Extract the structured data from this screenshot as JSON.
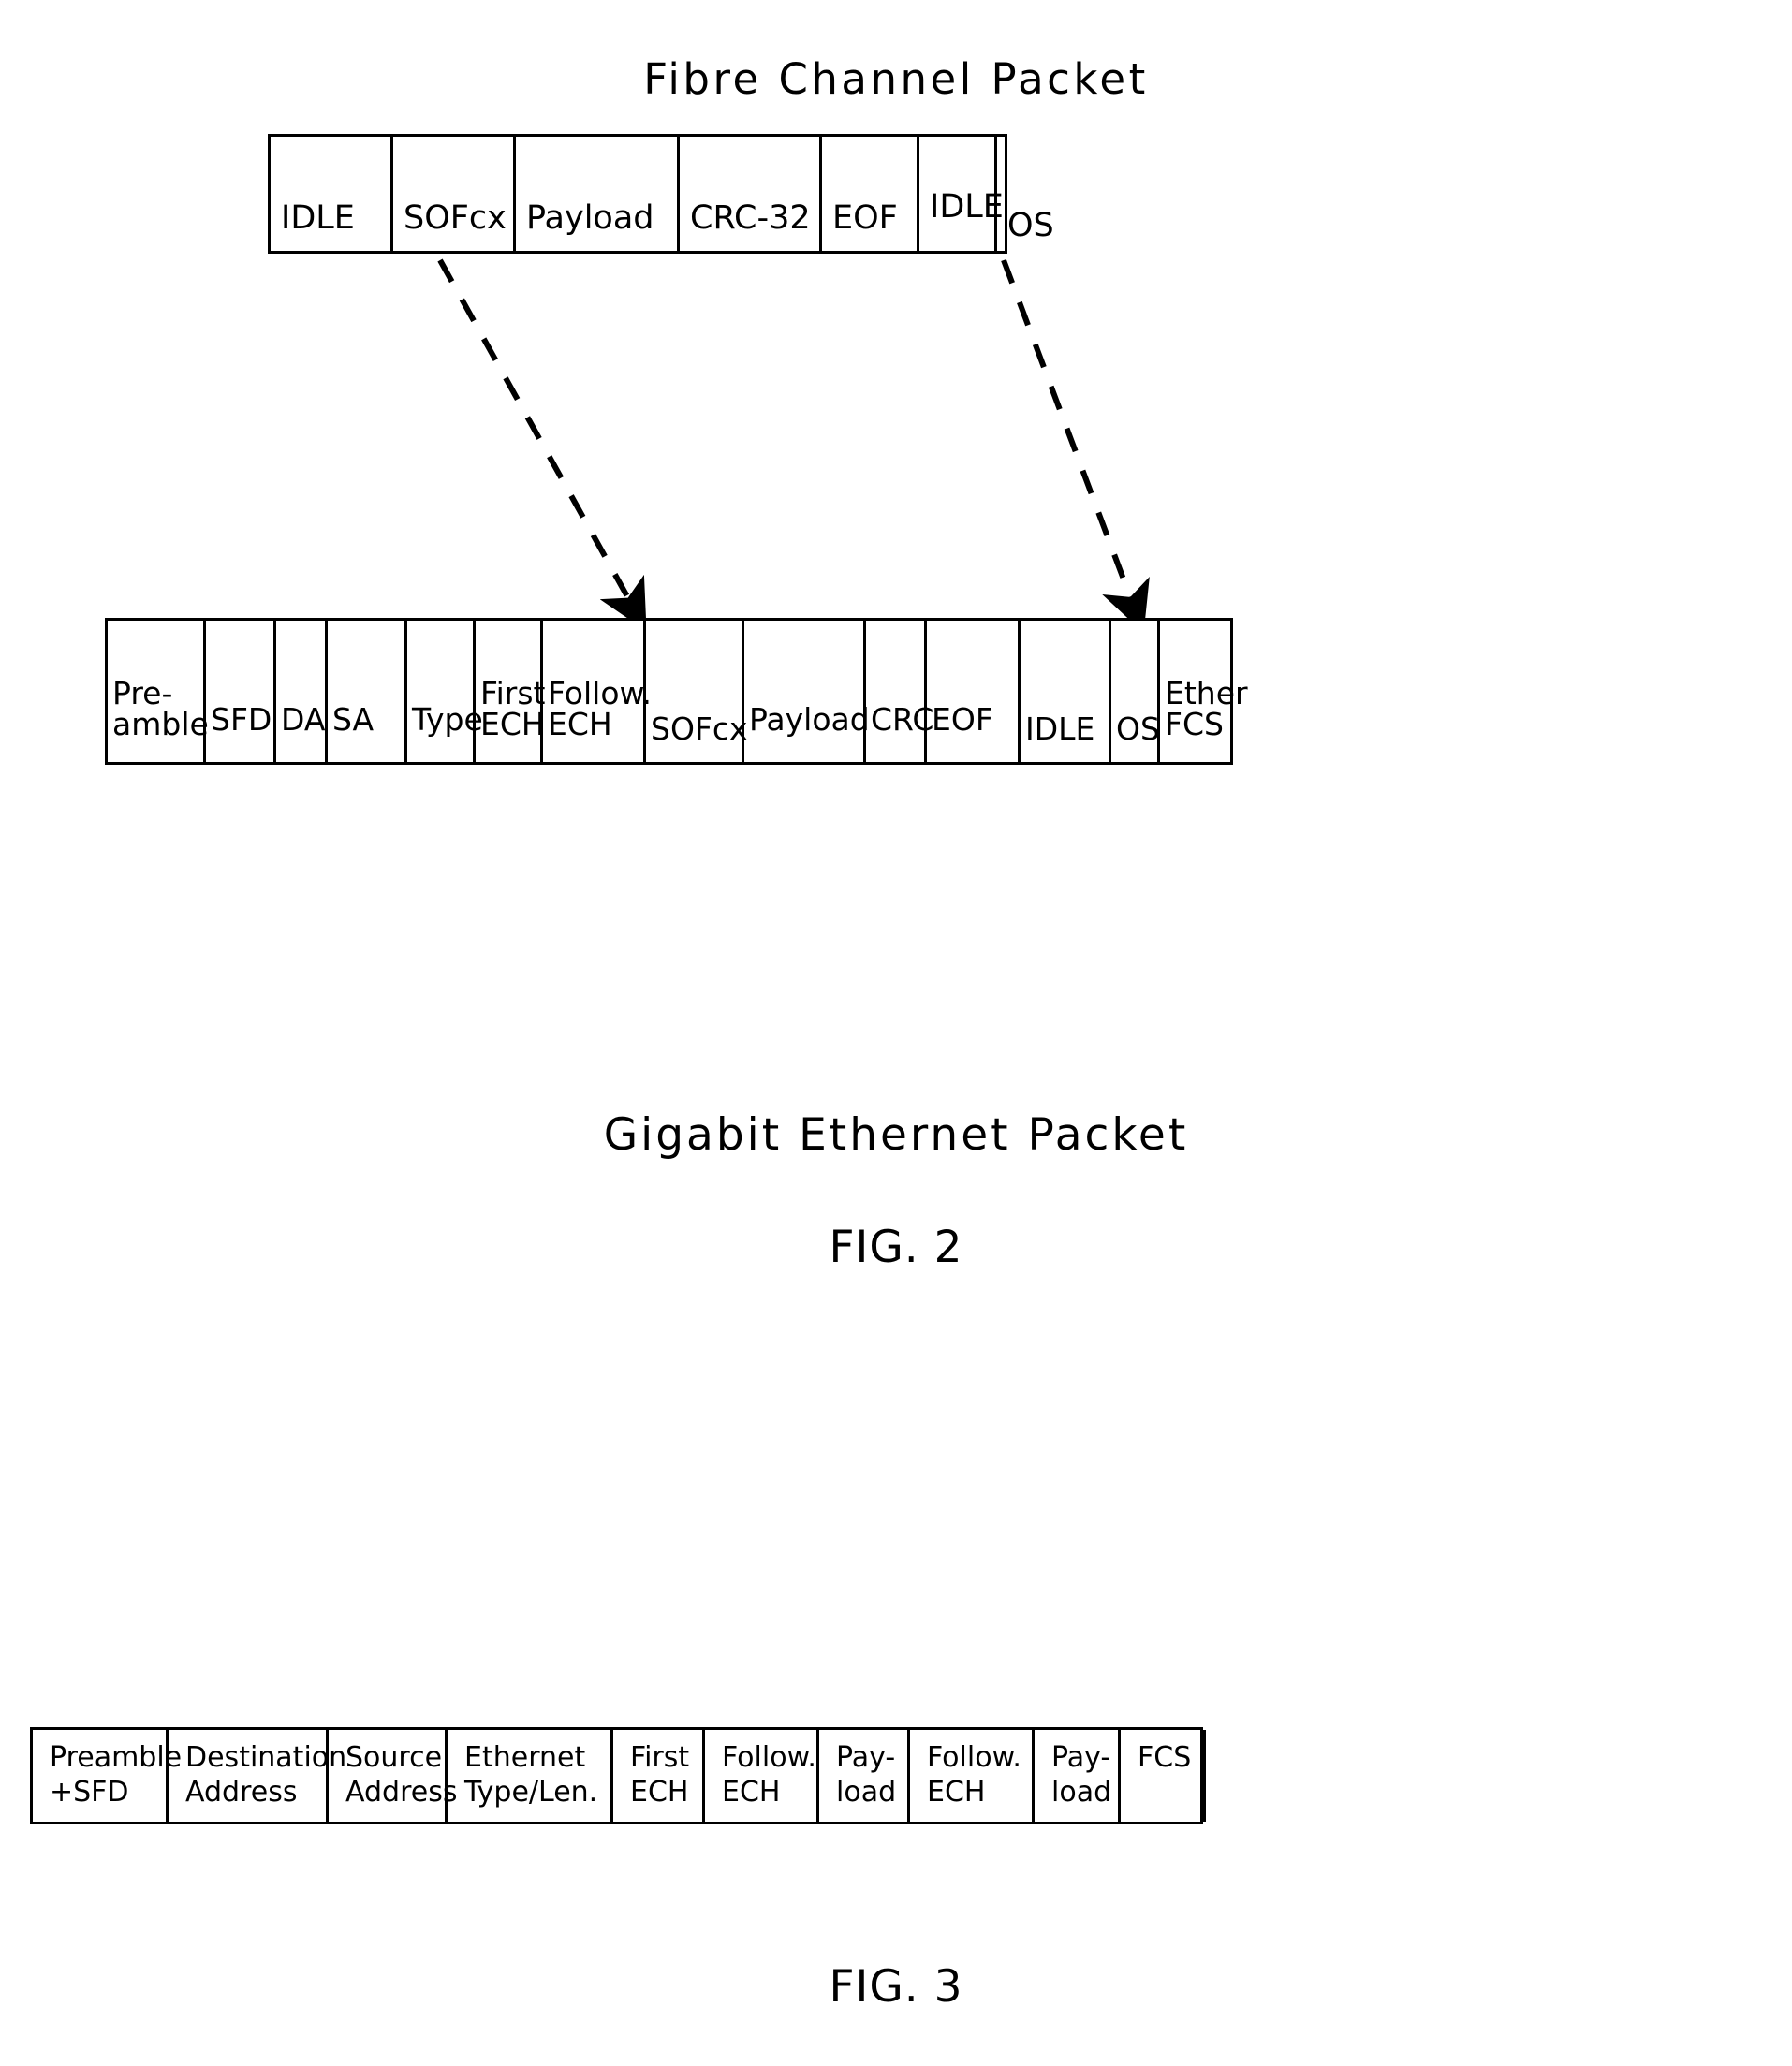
{
  "figure2": {
    "top_title": "Fibre Channel Packet",
    "bottom_title": "Gigabit Ethernet Packet",
    "caption": "FIG. 2",
    "fibre_channel_packet": {
      "name": "Fibre Channel Packet",
      "fields": [
        {
          "label": "IDLE",
          "width": 131
        },
        {
          "label": "SOFcx",
          "width": 131
        },
        {
          "label": "Payload",
          "width": 175
        },
        {
          "label": "CRC-32",
          "width": 152
        },
        {
          "label": "EOF",
          "width": 104
        },
        {
          "label": "IDLE",
          "width": 83
        },
        {
          "label": "OS",
          "width": 90
        }
      ]
    },
    "gigabit_ethernet_packet": {
      "name": "Gigabit Ethernet Packet",
      "fields": [
        {
          "label": "Pre-\namble",
          "width": 105
        },
        {
          "label": "SFD",
          "width": 75
        },
        {
          "label": "DA",
          "width": 55
        },
        {
          "label": "SA",
          "width": 85
        },
        {
          "label": "Type",
          "width": 73
        },
        {
          "label": "First\nECH",
          "width": 72
        },
        {
          "label": "Follow.\nECH",
          "width": 110
        },
        {
          "label": "SOFcx",
          "width": 105
        },
        {
          "label": "Payload",
          "width": 130
        },
        {
          "label": "CRC",
          "width": 65
        },
        {
          "label": "EOF",
          "width": 100
        },
        {
          "label": "IDLE",
          "width": 97
        },
        {
          "label": "OS",
          "width": 52
        },
        {
          "label": "Ether\nFCS",
          "width": 80
        }
      ]
    },
    "connectors": [
      {
        "from": "SOFcx (Fibre Channel)",
        "to": "SOFcx (Gigabit Ethernet)",
        "style": "dashed-arrow"
      },
      {
        "from": "OS (Fibre Channel)",
        "to": "OS (Gigabit Ethernet)",
        "style": "dashed-arrow"
      }
    ]
  },
  "figure3": {
    "caption": "FIG. 3",
    "frame_format": {
      "fields": [
        {
          "label": "Preamble\n+SFD",
          "width": 145
        },
        {
          "label": "Destination\nAddress",
          "width": 171
        },
        {
          "label": "Source\nAddress",
          "width": 127
        },
        {
          "label": "Ethernet\nType/Len.",
          "width": 177
        },
        {
          "label": "First\nECH",
          "width": 98
        },
        {
          "label": "Follow.\nECH",
          "width": 122
        },
        {
          "label": "Pay-\nload",
          "width": 97
        },
        {
          "label": "Follow.\nECH",
          "width": 133
        },
        {
          "label": "Pay-\nload",
          "width": 92
        },
        {
          "label": "FCS",
          "width": 91
        }
      ]
    }
  },
  "colors": {
    "ink": "#000000",
    "paper": "#ffffff"
  }
}
